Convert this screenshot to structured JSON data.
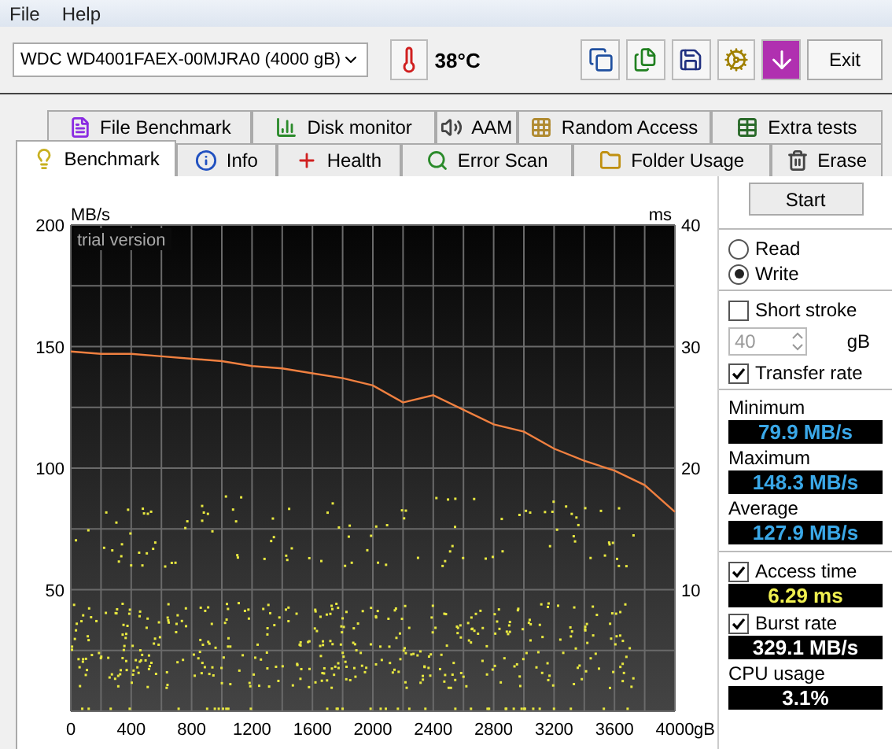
{
  "menu": [
    "File",
    "Help"
  ],
  "toolbar": {
    "drive": "WDC WD4001FAEX-00MJRA0 (4000 gB)",
    "temperature": "38°C",
    "exit": "Exit"
  },
  "tabs": [
    [
      {
        "label": "File Benchmark",
        "selected": false
      },
      {
        "label": "Disk monitor",
        "selected": false
      },
      {
        "label": "AAM",
        "selected": false
      },
      {
        "label": "Random Access",
        "selected": false
      },
      {
        "label": "Extra tests",
        "selected": false
      }
    ],
    [
      {
        "label": "Benchmark",
        "selected": true
      },
      {
        "label": "Info",
        "selected": false
      },
      {
        "label": "Health",
        "selected": false
      },
      {
        "label": "Error Scan",
        "selected": false
      },
      {
        "label": "Folder Usage",
        "selected": false
      },
      {
        "label": "Erase",
        "selected": false
      }
    ]
  ],
  "chart_data": {
    "type": "line",
    "ylabel": "MB/s",
    "y2label": "ms",
    "xlabel": "gB",
    "annotations": [
      "trial version"
    ],
    "x": [
      0,
      200,
      400,
      600,
      800,
      1000,
      1200,
      1400,
      1600,
      1800,
      2000,
      2200,
      2400,
      2600,
      2800,
      3000,
      3200,
      3400,
      3600,
      3800,
      4000
    ],
    "series": [
      {
        "color": "#f08040",
        "values": [
          148,
          147,
          147,
          146,
          145,
          144,
          142,
          141,
          139,
          137,
          134,
          127,
          130,
          124,
          118,
          115,
          108,
          103,
          99,
          93,
          82
        ]
      }
    ],
    "grid": true,
    "xlim": [
      0,
      4000
    ],
    "ylim": [
      0,
      200
    ],
    "y2lim": [
      0,
      40
    ],
    "xticks": [
      0,
      400,
      800,
      1200,
      1600,
      2000,
      2400,
      2800,
      3200,
      3600,
      4000
    ],
    "yticks": [
      50,
      100,
      150,
      200
    ],
    "y2ticks": [
      10,
      20,
      30,
      40
    ]
  },
  "panel": {
    "start": "Start",
    "modes": [
      {
        "label": "Read",
        "selected": false
      },
      {
        "label": "Write",
        "selected": true
      }
    ],
    "short_stroke": {
      "label": "Short stroke",
      "checked": false,
      "value": "40",
      "disabled": true,
      "unit": "gB"
    },
    "transfer": {
      "label": "Transfer rate",
      "checked": true,
      "readouts": [
        {
          "label": "Minimum",
          "value": "79.9 MB/s"
        },
        {
          "label": "Maximum",
          "value": "148.3 MB/s"
        },
        {
          "label": "Average",
          "value": "127.9 MB/s"
        }
      ]
    },
    "access": {
      "label": "Access time",
      "checked": true,
      "value": "6.29 ms"
    },
    "burst": {
      "label": "Burst rate",
      "checked": true,
      "value": "329.1 MB/s"
    },
    "cpu": {
      "label": "CPU usage",
      "value": "3.1%"
    }
  }
}
